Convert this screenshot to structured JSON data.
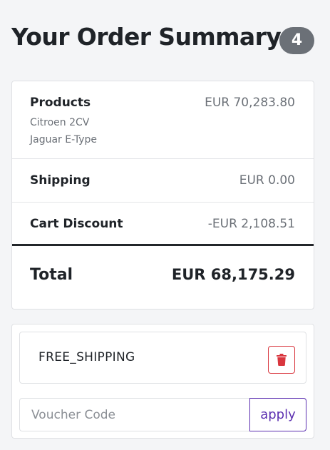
{
  "header": {
    "title": "Your Order Summary",
    "item_count": "4"
  },
  "summary": {
    "products": {
      "label": "Products",
      "value": "EUR 70,283.80",
      "items": [
        "Citroen 2CV",
        "Jaguar E-Type"
      ]
    },
    "shipping": {
      "label": "Shipping",
      "value": "EUR 0.00"
    },
    "discount": {
      "label": "Cart Discount",
      "value": "-EUR 2,108.51"
    },
    "total": {
      "label": "Total",
      "value": "EUR 68,175.29"
    }
  },
  "voucher": {
    "applied_code": "FREE_SHIPPING",
    "delete_icon": "trash-icon",
    "input_placeholder": "Voucher Code",
    "apply_label": "apply"
  },
  "colors": {
    "accent": "#5b2fb0",
    "danger": "#d9363e",
    "badge": "#6b7077"
  }
}
